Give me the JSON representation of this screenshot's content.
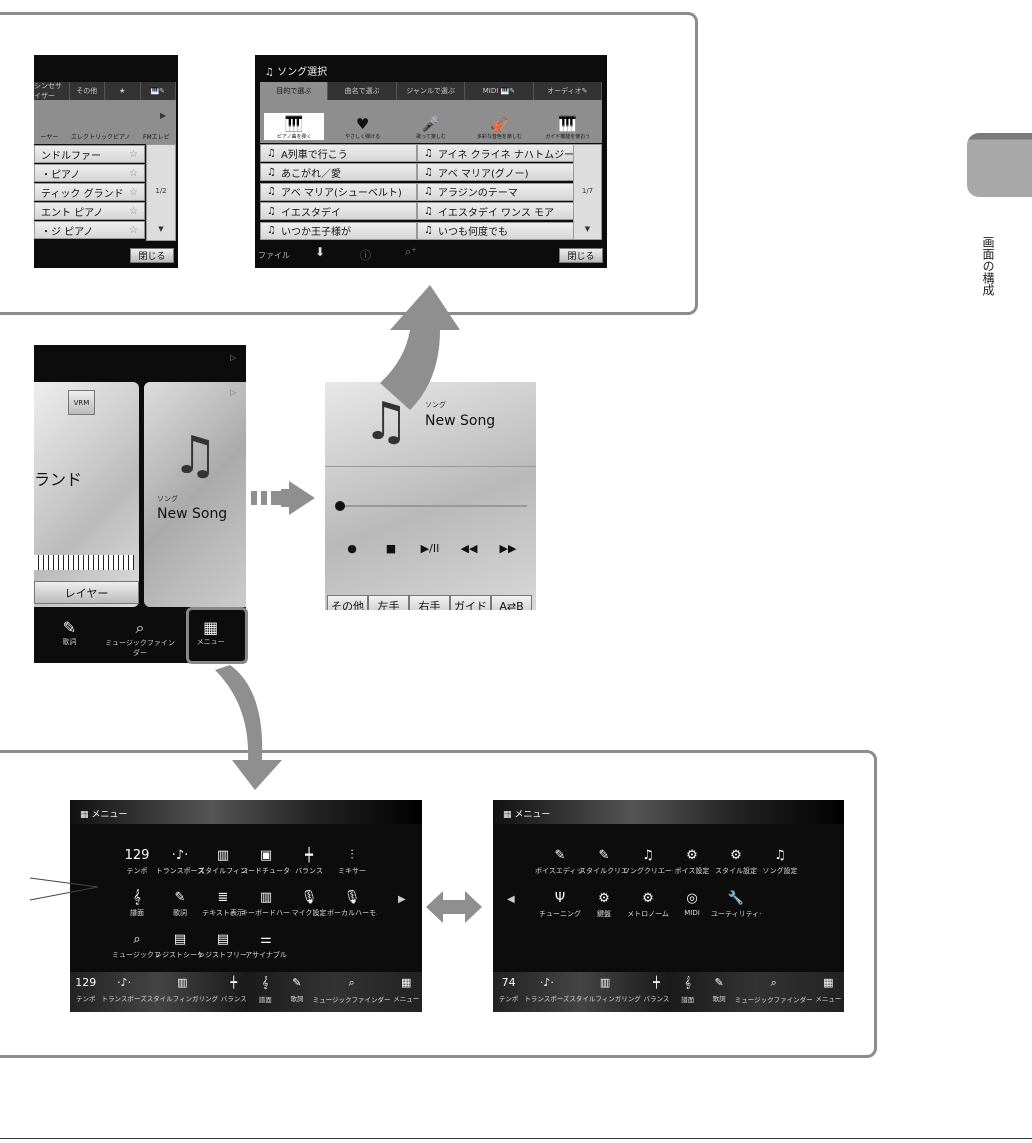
{
  "side_tab": {
    "label": "画面の構成"
  },
  "voice_select": {
    "tabs": [
      "シンセサイザー",
      "その他",
      "★",
      "🎹✎"
    ],
    "categories": [
      "ーヤー",
      "エレクトリックピアノ",
      "FMエレピ"
    ],
    "items": [
      "ンドルファー",
      "・ピアノ",
      "ティック グランド",
      "エント ピアノ",
      "・ジ ピアノ"
    ],
    "page": "1/2",
    "close": "閉じる"
  },
  "song_select": {
    "title": "ソング選択",
    "tabs": [
      "目的で選ぶ",
      "曲名で選ぶ",
      "ジャンルで選ぶ",
      "MIDI 🎹✎",
      "オーディオ✎"
    ],
    "categories": [
      "ピアノ曲を弾く",
      "やさしく弾ける",
      "歌って楽しむ",
      "多彩な音色を楽しむ",
      "ガイド機能を使おう"
    ],
    "songs": [
      "A列車で行こう",
      "アイネ クライネ ナハトムジーク",
      "あこがれ／愛",
      "アベ マリア(グノー)",
      "アベ マリア(シューベルト)",
      "アラジンのテーマ",
      "イエスタデイ",
      "イエスタデイ ワンス モア",
      "いつか王子様が",
      "いつも何度でも"
    ],
    "page": "1/7",
    "footer": {
      "file": "ファイル",
      "close": "閉じる"
    }
  },
  "home": {
    "vrm": "VRM",
    "voice_name": "ランド",
    "layer": "レイヤー",
    "song_label": "ソング",
    "song_name": "New Song",
    "bottom": [
      {
        "icon": "lyrics",
        "label": "歌詞"
      },
      {
        "icon": "music-finder",
        "label": "ミュージックファインダー"
      },
      {
        "icon": "menu",
        "label": "メニュー"
      }
    ]
  },
  "song_panel": {
    "label": "ソング",
    "name": "New Song",
    "position_percent": 0,
    "transport": [
      "●",
      "■",
      "▶/II",
      "◀◀",
      "▶▶"
    ],
    "buttons": [
      "その他",
      "左手",
      "右手",
      "ガイド",
      "A⇄B"
    ]
  },
  "menu1": {
    "title": "メニュー",
    "items": [
      {
        "icon": "129",
        "label": "テンポ"
      },
      {
        "icon": "·♪·",
        "label": "トランスポーズ"
      },
      {
        "icon": "▥",
        "label": "スタイルフィンガリング"
      },
      {
        "icon": "▣",
        "label": "コードチューター"
      },
      {
        "icon": "┿",
        "label": "バランス"
      },
      {
        "icon": "⫶",
        "label": "ミキサー"
      },
      {
        "icon": "𝄞",
        "label": "譜面"
      },
      {
        "icon": "✎",
        "label": "歌詞"
      },
      {
        "icon": "≣",
        "label": "テキスト表示"
      },
      {
        "icon": "▥",
        "label": "キーボードハーモニー"
      },
      {
        "icon": "🎙",
        "label": "マイク設定"
      },
      {
        "icon": "🎙",
        "label": "ボーカルハーモニー"
      },
      {
        "icon": "⌕",
        "label": "ミュージックファインダー"
      },
      {
        "icon": "▤",
        "label": "レジストシーケンス"
      },
      {
        "icon": "▤",
        "label": "レジストフリーズ"
      },
      {
        "icon": "⚌",
        "label": "アサイナブル"
      }
    ]
  },
  "menu2": {
    "title": "メニュー",
    "items": [
      {
        "icon": "✎",
        "label": "ボイスエディット"
      },
      {
        "icon": "✎",
        "label": "スタイルクリエーター"
      },
      {
        "icon": "♫",
        "label": "ソングクリエーター"
      },
      {
        "icon": "⚙",
        "label": "ボイス設定"
      },
      {
        "icon": "⚙",
        "label": "スタイル設定"
      },
      {
        "icon": "♫",
        "label": "ソング設定"
      },
      {
        "icon": "Ψ",
        "label": "チューニング"
      },
      {
        "icon": "⚙",
        "label": "鍵盤"
      },
      {
        "icon": "⚙",
        "label": "メトロノーム"
      },
      {
        "icon": "◎",
        "label": "MIDI"
      },
      {
        "icon": "🔧",
        "label": "ユーティリティー"
      }
    ]
  },
  "bottom_bar1": {
    "tempo": "129",
    "items": [
      "テンポ",
      "トランスポーズ",
      "スタイルフィンガリング",
      "バランス",
      "譜面",
      "歌詞",
      "ミュージックファインダー",
      "メニュー"
    ]
  },
  "bottom_bar2": {
    "tempo": "74",
    "items": [
      "テンポ",
      "トランスポーズ",
      "スタイルフィンガリング",
      "バランス",
      "譜面",
      "歌詞",
      "ミュージックファインダー",
      "メニュー"
    ]
  }
}
